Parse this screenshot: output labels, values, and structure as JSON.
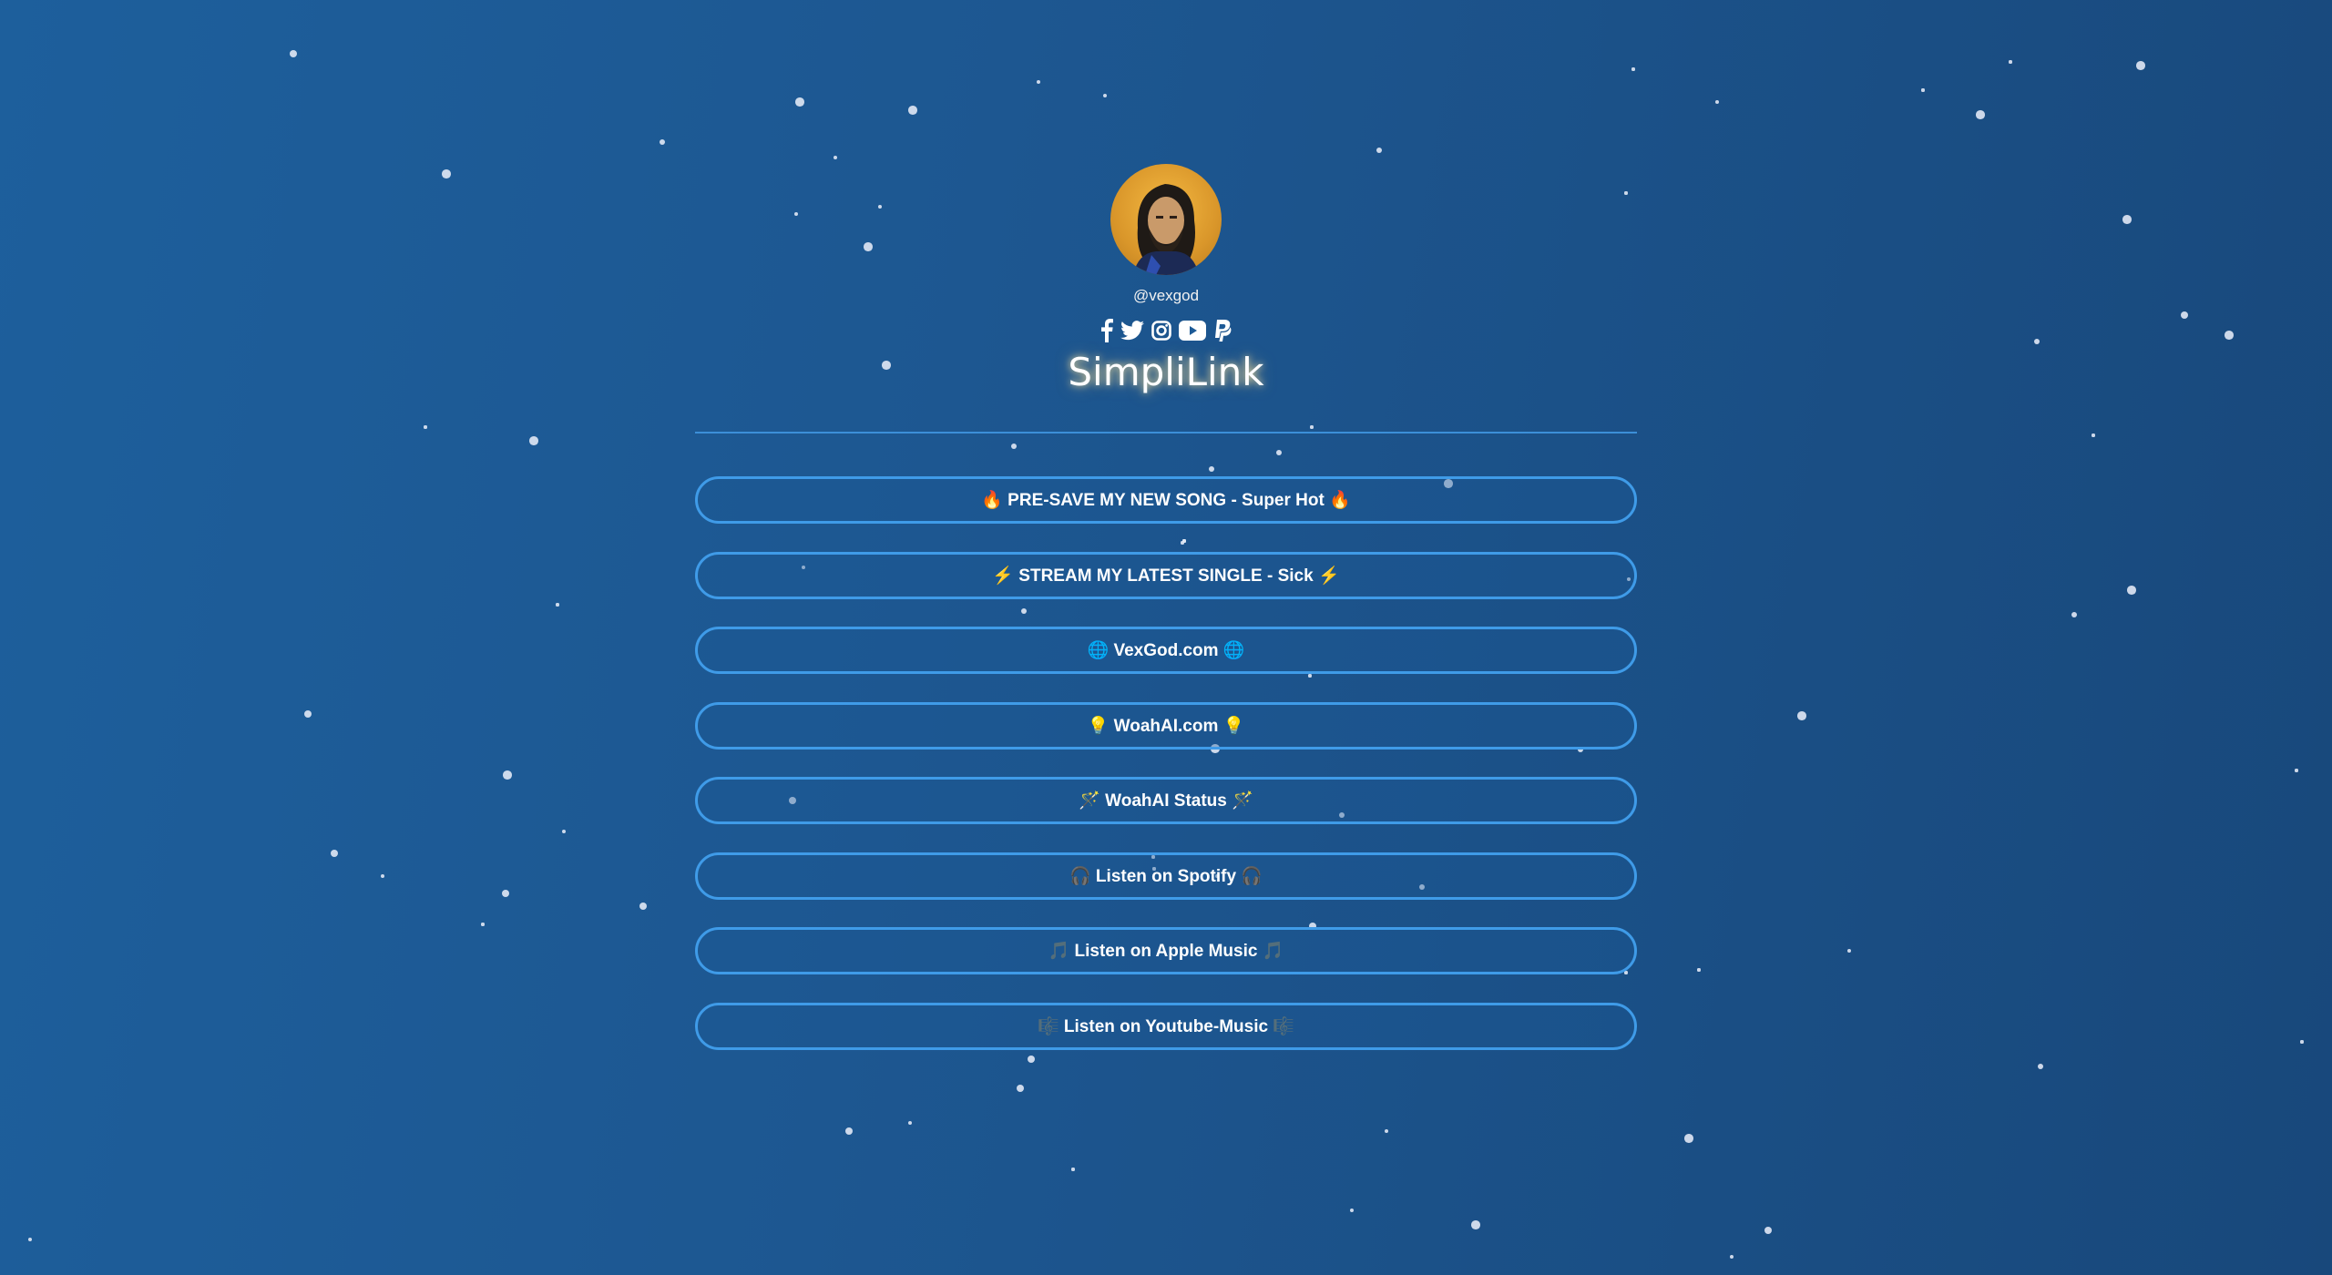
{
  "profile": {
    "handle": "@vexgod",
    "brand_title": "SimpliLink"
  },
  "socials": [
    {
      "icon": "facebook-icon"
    },
    {
      "icon": "twitter-icon"
    },
    {
      "icon": "instagram-icon"
    },
    {
      "icon": "youtube-icon"
    },
    {
      "icon": "paypal-icon"
    }
  ],
  "links": [
    {
      "label": "🔥 PRE-SAVE MY NEW SONG - Super Hot 🔥"
    },
    {
      "label": "⚡ STREAM MY LATEST SINGLE - Sick ⚡"
    },
    {
      "label": "🌐 VexGod.com 🌐"
    },
    {
      "label": "💡 WoahAI.com 💡"
    },
    {
      "label": "🪄 WoahAI Status 🪄"
    },
    {
      "label": "🎧 Listen on Spotify 🎧"
    },
    {
      "label": "🎵 Listen on Apple Music 🎵"
    },
    {
      "label": "🎼 Listen on Youtube-Music 🎼"
    }
  ],
  "colors": {
    "background": "#1d5a96",
    "button_border": "#3f9be8",
    "divider": "#3c8fd8",
    "avatar_bg": "#e0a030"
  }
}
